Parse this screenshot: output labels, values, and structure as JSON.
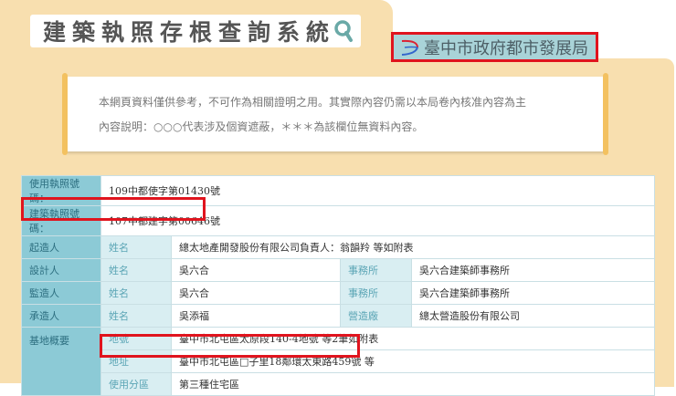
{
  "header": {
    "title": "建築執照存根查詢系統",
    "search_icon": "search-icon",
    "org": "臺中市政府都市發展局",
    "org_logo": "taichung-logo-icon"
  },
  "notice": {
    "line1": "本網頁資料僅供參考，不可作為相關證明之用。其實際內容仍需以本局卷內核准內容為主",
    "line2": "內容說明：○○○代表涉及個資遮蔽，＊＊＊為該欄位無資料內容。"
  },
  "record": {
    "use_permit_label": "使用執照號碼：",
    "use_permit": "109中都使字第01430號",
    "build_permit_label": "建築執照號碼：",
    "build_permit": "107中都建字第00646號",
    "applicant": {
      "label": "起造人",
      "name_label": "姓名",
      "name": "總太地產開發股份有限公司負責人：翁韻羚 等如附表"
    },
    "designer": {
      "label": "設計人",
      "name_label": "姓名",
      "name": "吳六合",
      "office_label": "事務所",
      "office": "吳六合建築師事務所"
    },
    "supervisor": {
      "label": "監造人",
      "name_label": "姓名",
      "name": "吳六合",
      "office_label": "事務所",
      "office": "吳六合建築師事務所"
    },
    "contractor": {
      "label": "承造人",
      "name_label": "姓名",
      "name": "吳添福",
      "office_label": "營造廠",
      "office": "總太營造股份有限公司"
    },
    "site": {
      "label": "基地概要",
      "lot_label": "地號",
      "lot": "臺中市北屯區太原段140-4地號 等2筆如附表",
      "address_label": "地址",
      "address": "臺中市北屯區□子里18鄰環太東路459號 等",
      "zone_label": "使用分區",
      "zone": "第三種住宅區"
    }
  },
  "colors": {
    "beige": "#f8dfaf",
    "teal": "#8ccad6",
    "highlight": "#e0141e"
  }
}
